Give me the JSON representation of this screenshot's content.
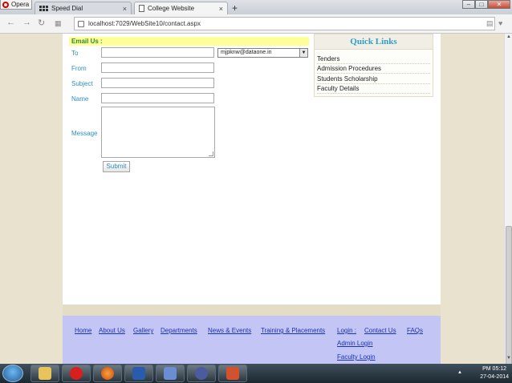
{
  "browser": {
    "menu_label": "Opera",
    "tabs": [
      {
        "title": "Speed Dial",
        "close": "×"
      },
      {
        "title": "College Website",
        "close": "×"
      }
    ],
    "new_tab": "+",
    "address": "localhost:7029/WebSite10/contact.aspx"
  },
  "form": {
    "section_title": "Email Us :",
    "labels": {
      "to": "To",
      "from": "From",
      "subject": "Subject",
      "name": "Name",
      "message": "Message"
    },
    "to_select_value": "mjpknw@dataone.in",
    "submit_label": "Submit"
  },
  "quick_links": {
    "title": "Quick Links",
    "items": [
      "Tenders",
      "Admission Procedures",
      "Students Scholarship",
      "Faculty Details"
    ]
  },
  "footer": {
    "links": [
      "Home",
      "About Us",
      "Gallery",
      "Departments",
      "News & Events",
      "Training & Placements",
      "Login :",
      "Contact Us",
      "FAQs",
      "Admin Login",
      "Faculty Login"
    ]
  },
  "taskbar": {
    "time": "PM 05:12",
    "date": "27-04-2014"
  },
  "colors": {
    "accent": "#2e8fc0",
    "footer_bg": "#c3c6f5",
    "email_header_bg": "#ffff99"
  }
}
